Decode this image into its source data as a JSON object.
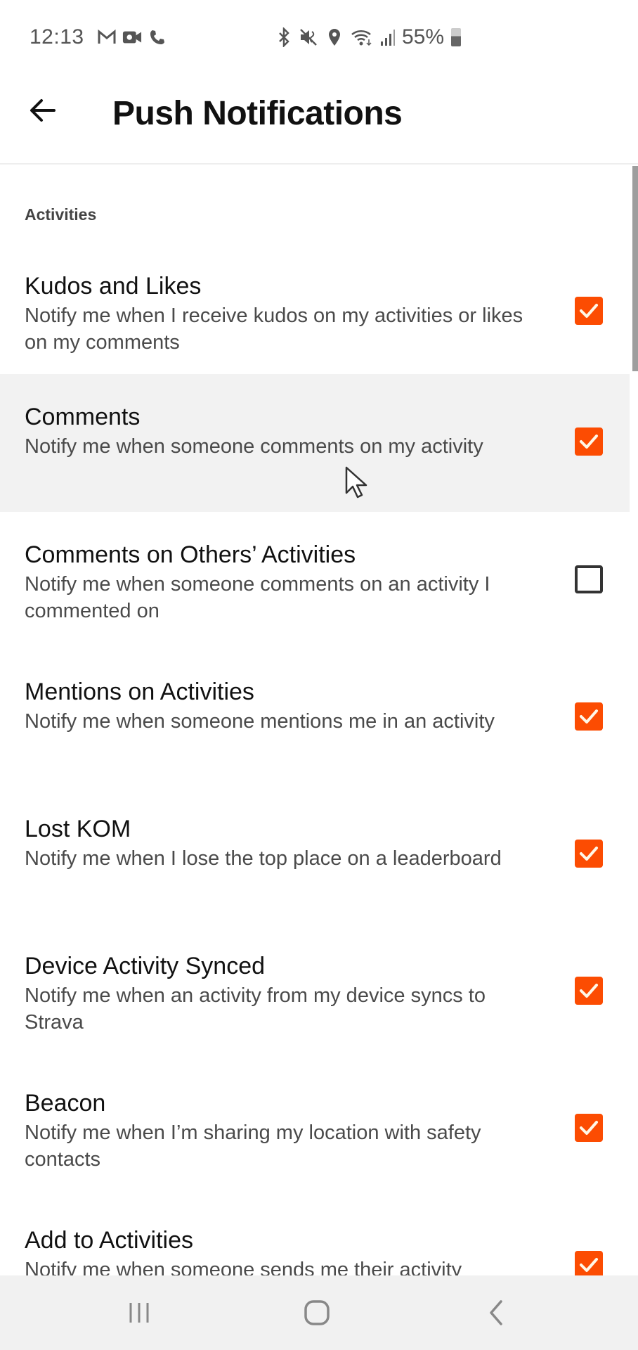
{
  "status_bar": {
    "time": "12:13",
    "left_icons": [
      "gmail-icon",
      "video-call-icon",
      "phone-icon"
    ],
    "right_icons": [
      "bluetooth-icon",
      "mute-icon",
      "location-icon",
      "wifi-icon",
      "signal-icon"
    ],
    "battery": "55%"
  },
  "app_bar": {
    "back_icon": "arrow-left-icon",
    "title": "Push Notifications"
  },
  "section": {
    "header": "Activities"
  },
  "settings": [
    {
      "title": "Kudos and Likes",
      "description": "Notify me when I receive kudos on my activities or likes on my comments",
      "checked": true
    },
    {
      "title": "Comments",
      "description": "Notify me when someone comments on my activity",
      "checked": true
    },
    {
      "title": "Comments on Others’ Activities",
      "description": "Notify me when someone comments on an activity I commented on",
      "checked": false
    },
    {
      "title": "Mentions on Activities",
      "description": "Notify me when someone mentions me in an activity",
      "checked": true
    },
    {
      "title": "Lost KOM",
      "description": "Notify me when I lose the top place on a leaderboard",
      "checked": true
    },
    {
      "title": "Device Activity Synced",
      "description": "Notify me when an activity from my device syncs to Strava",
      "checked": true
    },
    {
      "title": "Beacon",
      "description": "Notify me when I’m sharing my location with safety contacts",
      "checked": true
    },
    {
      "title": "Add to Activities",
      "description": "Notify me when someone sends me their activity",
      "checked": true
    }
  ],
  "colors": {
    "accent": "#fc4c02",
    "pressed_row": "#f2f2f2"
  },
  "nav_bar": {
    "buttons": [
      "recents-icon",
      "home-icon",
      "back-icon"
    ]
  }
}
